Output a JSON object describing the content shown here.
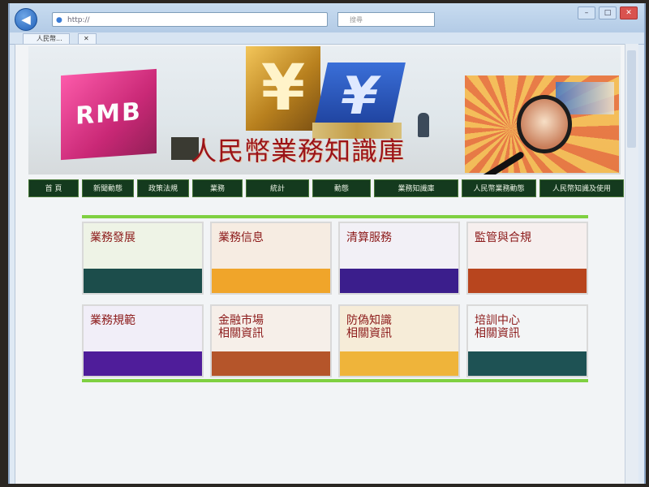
{
  "browser": {
    "address_text": "http://",
    "search_placeholder": "搜尋",
    "tab_label": "人民幣...",
    "tab2_label": "✕"
  },
  "window_controls": [
    "–",
    "□",
    "✕"
  ],
  "banner": {
    "rmb_text": "RMB",
    "yen_gold": "¥",
    "yen_blue": "¥",
    "title": "人民幣業務知識庫"
  },
  "nav": [
    {
      "label": "首 頁"
    },
    {
      "label": "新聞動態"
    },
    {
      "label": "政策法規"
    },
    {
      "label": "業務"
    },
    {
      "label": "統計"
    },
    {
      "label": "動態"
    },
    {
      "label": "業務知識庫"
    },
    {
      "label": "人民幣業務動態"
    },
    {
      "label": "人民幣知識及使用"
    }
  ],
  "cards": [
    {
      "label": "業務發展",
      "top": "#eef3e6",
      "bar": "#1c4d4b"
    },
    {
      "label": "業務信息",
      "top": "#f6ece2",
      "bar": "#f0a52a"
    },
    {
      "label": "清算服務",
      "top": "#f2f0f6",
      "bar": "#3b1e8c"
    },
    {
      "label": "監管與合規",
      "top": "#f6efee",
      "bar": "#b8451e"
    },
    {
      "label": "業務規範",
      "top": "#f1eef8",
      "bar": "#4f1d9a"
    },
    {
      "label": "金融市場\n相關資訊",
      "top": "#f6efe9",
      "bar": "#b5552a"
    },
    {
      "label": "防偽知識\n相關資訊",
      "top": "#f6ecd8",
      "bar": "#efb43a"
    },
    {
      "label": "培訓中心\n相關資訊",
      "top": "#f3f5f6",
      "bar": "#1e5254"
    }
  ]
}
